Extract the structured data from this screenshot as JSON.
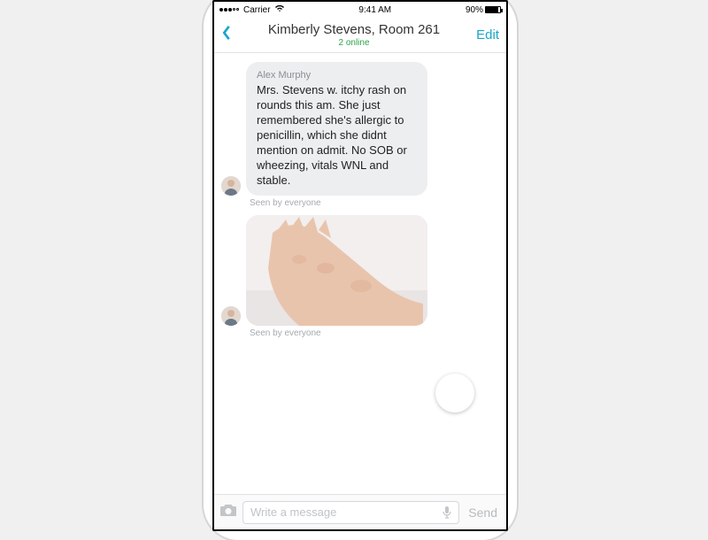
{
  "statusbar": {
    "carrier": "Carrier",
    "time": "9:41 AM",
    "battery_pct": "90%"
  },
  "navbar": {
    "title": "Kimberly Stevens, Room 261",
    "subtitle": "2 online",
    "edit": "Edit"
  },
  "messages": {
    "m0": {
      "sender": "Alex Murphy",
      "body": "Mrs. Stevens w. itchy rash on rounds this am.  She just remembered she's allergic to penicillin, which she didnt mention on admit. No SOB or wheezing, vitals WNL and stable.",
      "seen": "Seen by everyone"
    },
    "m1": {
      "type": "image",
      "seen": "Seen by everyone"
    }
  },
  "input": {
    "placeholder": "Write a message",
    "send": "Send"
  }
}
